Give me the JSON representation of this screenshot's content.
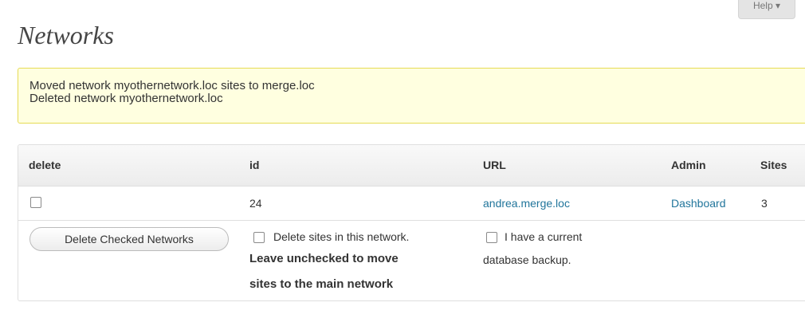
{
  "help_tab": {
    "label": "Help ▾"
  },
  "page": {
    "title": "Networks"
  },
  "notice": {
    "lines": [
      "Moved network myothernetwork.loc sites to merge.loc",
      "Deleted network myothernetwork.loc"
    ]
  },
  "table": {
    "headers": [
      "delete",
      "id",
      "URL",
      "Admin",
      "Sites"
    ],
    "rows": [
      {
        "checked": false,
        "id": "24",
        "url": "andrea.merge.loc",
        "admin_link": "Dashboard",
        "sites": "3"
      }
    ]
  },
  "actions": {
    "delete_button": "Delete Checked Networks",
    "delete_sites_label": "Delete sites in this network.",
    "delete_sites_note_line1": "Leave unchecked to move",
    "delete_sites_note_line2": "sites to the main network",
    "backup_label_line1": "I have a current",
    "backup_label_line2": "database backup."
  },
  "colors": {
    "link": "#21759b",
    "notice_bg": "#ffffe0",
    "notice_border": "#e6db55"
  }
}
